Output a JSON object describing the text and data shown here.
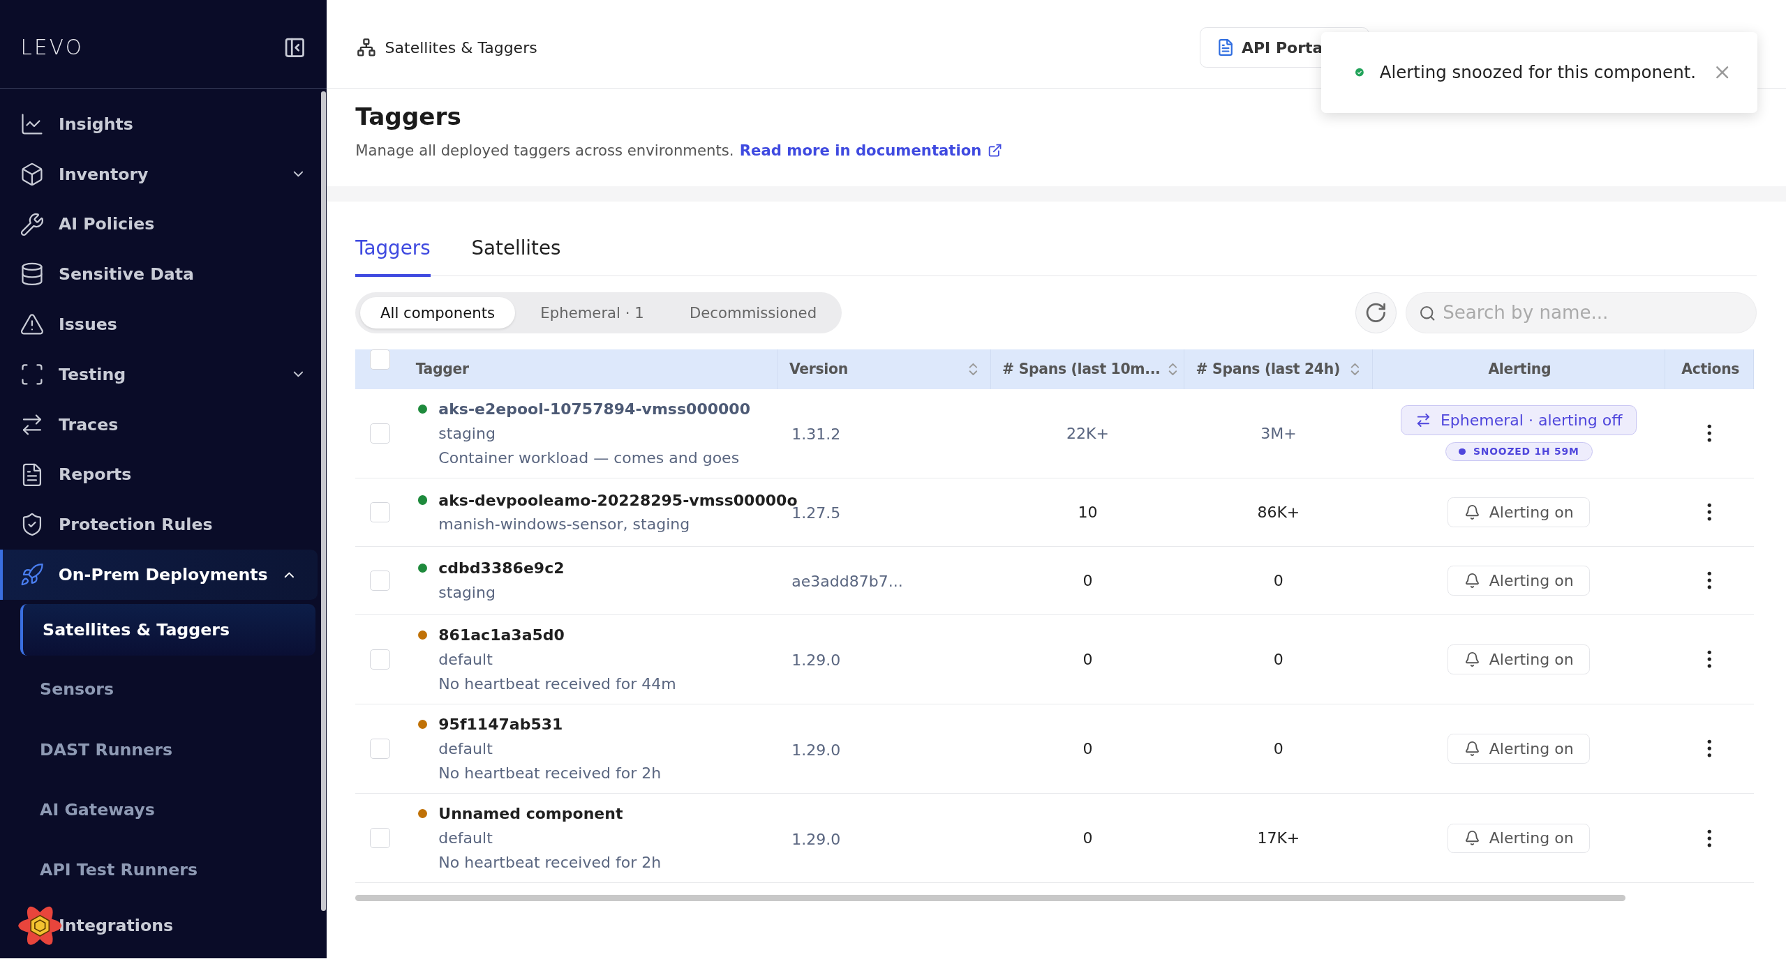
{
  "sidebar": {
    "logo": "LEVO",
    "items": [
      {
        "label": "Insights",
        "selected": false
      },
      {
        "label": "Inventory",
        "selected": false,
        "expanded": false
      },
      {
        "label": "AI Policies",
        "selected": false
      },
      {
        "label": "Sensitive Data",
        "selected": false
      },
      {
        "label": "Issues",
        "selected": false
      },
      {
        "label": "Testing",
        "selected": false,
        "expanded": false
      },
      {
        "label": "Traces",
        "selected": false
      },
      {
        "label": "Reports",
        "selected": false
      },
      {
        "label": "Protection Rules",
        "selected": false
      },
      {
        "label": "On-Prem Deployments",
        "selected": true,
        "expanded": true,
        "children": [
          {
            "label": "Satellites & Taggers",
            "selected": true
          },
          {
            "label": "Sensors",
            "selected": false
          },
          {
            "label": "DAST Runners",
            "selected": false
          },
          {
            "label": "AI Gateways",
            "selected": false
          },
          {
            "label": "API Test Runners",
            "selected": false
          }
        ]
      },
      {
        "label": "Integrations",
        "selected": false
      }
    ]
  },
  "topbar": {
    "breadcrumb": "Satellites & Taggers",
    "api_portal_button": "API Porta"
  },
  "toast": {
    "message": "Alerting snoozed for this component."
  },
  "header": {
    "title": "Taggers",
    "subtitle": "Manage all deployed taggers across environments.",
    "link": "Read more in documentation"
  },
  "tabs": [
    {
      "label": "Taggers",
      "selected": true
    },
    {
      "label": "Satellites",
      "selected": false
    }
  ],
  "filters": [
    {
      "label": "All components",
      "selected": true
    },
    {
      "label": "Ephemeral · 1",
      "selected": false
    },
    {
      "label": "Decommissioned",
      "selected": false
    }
  ],
  "search": {
    "placeholder": "Search by name..."
  },
  "table": {
    "select_all": {
      "checked": false
    },
    "columns": [
      {
        "label": "Tagger",
        "sortable": false
      },
      {
        "label": "Version",
        "sortable": true
      },
      {
        "label": "# Spans (last 10m...",
        "sortable": true
      },
      {
        "label": "# Spans (last 24h)",
        "sortable": true
      },
      {
        "label": "Alerting",
        "sortable": false
      },
      {
        "label": "Actions",
        "sortable": false
      }
    ],
    "rows": [
      {
        "checked": false,
        "color": "#1e8a3c",
        "name": "aks-e2epool-10757894-vmss000000",
        "details": [
          "staging",
          "Container workload — comes and goes"
        ],
        "version": "1.31.2",
        "spans_10m": "22K+",
        "spans_24h": "3M+",
        "alerting": {
          "kind": "ephemeral",
          "label": "Ephemeral · alerting off",
          "snooze": "SNOOZED 1H 59M"
        }
      },
      {
        "checked": false,
        "color": "#1e8a3c",
        "name": "aks-devpooleamo-20228295-vmss00000o",
        "details": [
          "manish-windows-sensor, staging"
        ],
        "version": "1.27.5",
        "spans_10m": "10",
        "spans_24h": "86K+",
        "alerting": {
          "kind": "on",
          "label": "Alerting on"
        }
      },
      {
        "checked": false,
        "color": "#1e8a3c",
        "name": "cdbd3386e9c2",
        "details": [
          "staging"
        ],
        "version": "ae3add87b7...",
        "spans_10m": "0",
        "spans_24h": "0",
        "alerting": {
          "kind": "on",
          "label": "Alerting on"
        }
      },
      {
        "checked": false,
        "color": "#c07106",
        "name": "861ac1a3a5d0",
        "details": [
          "default",
          "No heartbeat received for 44m"
        ],
        "version": "1.29.0",
        "spans_10m": "0",
        "spans_24h": "0",
        "alerting": {
          "kind": "on",
          "label": "Alerting on"
        }
      },
      {
        "checked": false,
        "color": "#c07106",
        "name": "95f1147ab531",
        "details": [
          "default",
          "No heartbeat received for 2h"
        ],
        "version": "1.29.0",
        "spans_10m": "0",
        "spans_24h": "0",
        "alerting": {
          "kind": "on",
          "label": "Alerting on"
        }
      },
      {
        "checked": false,
        "color": "#c07106",
        "name": "Unnamed component",
        "details": [
          "default",
          "No heartbeat received for 2h"
        ],
        "version": "1.29.0",
        "spans_10m": "0",
        "spans_24h": "17K+",
        "alerting": {
          "kind": "on",
          "label": "Alerting on"
        }
      }
    ]
  }
}
